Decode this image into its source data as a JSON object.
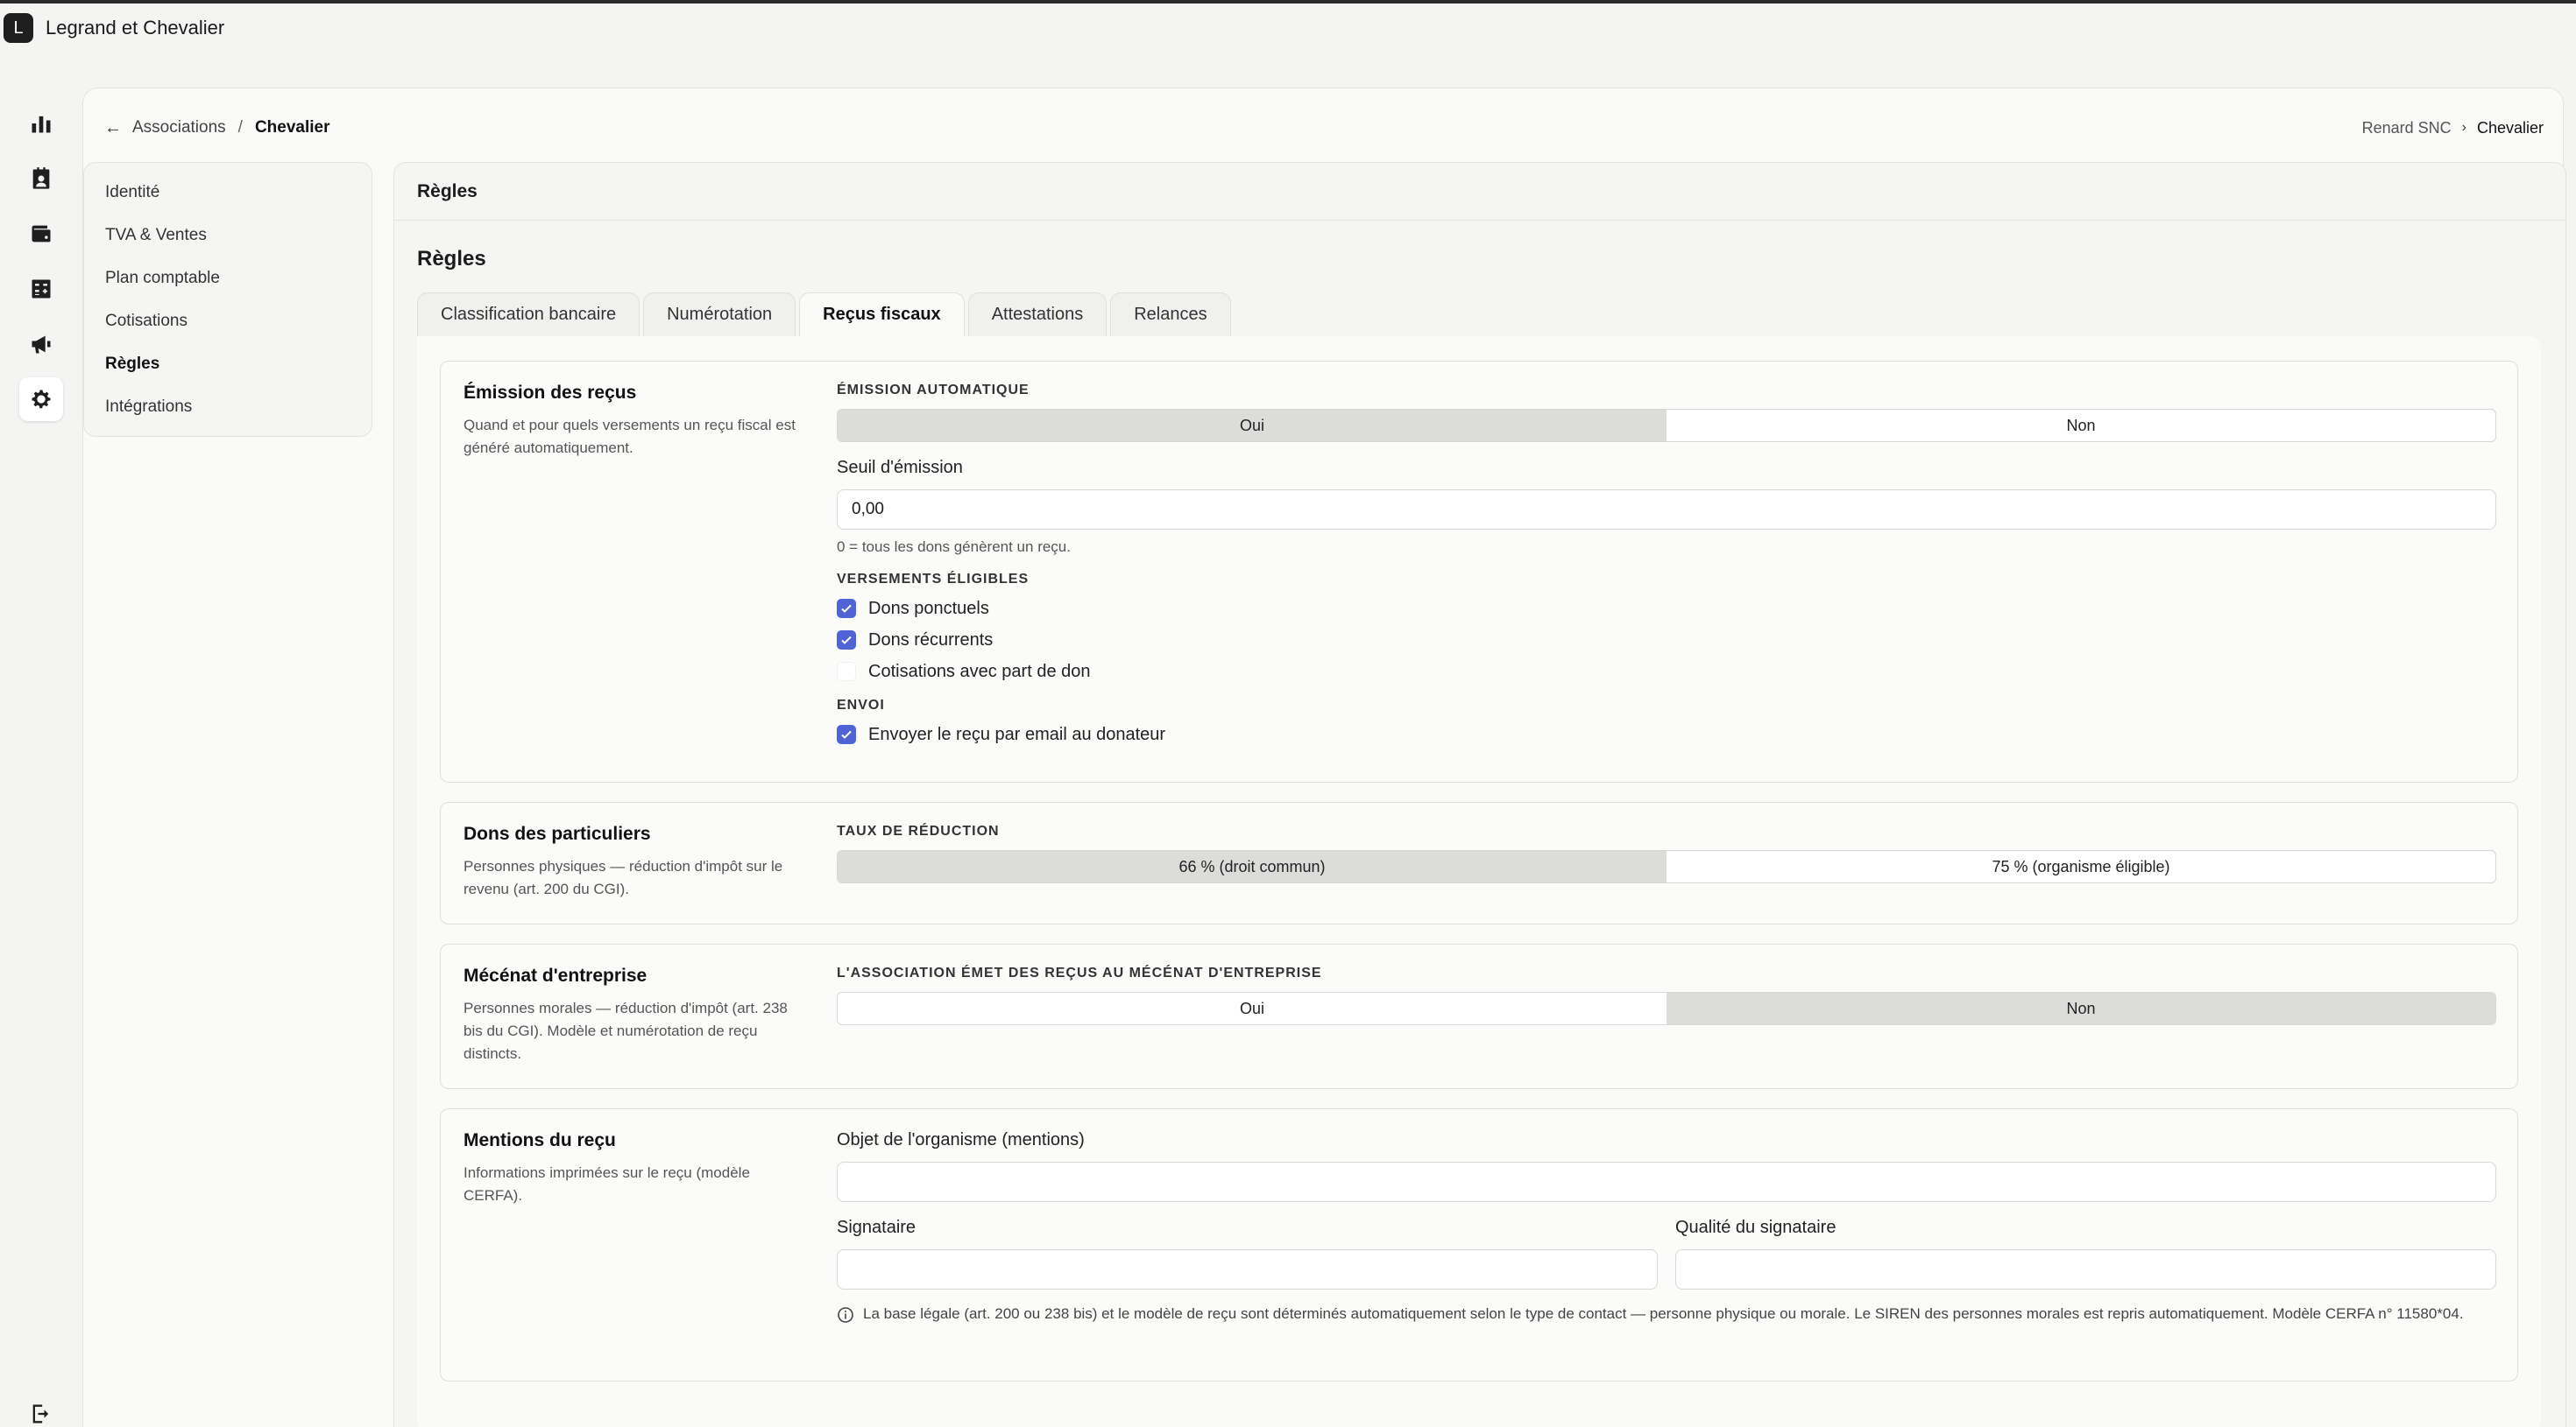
{
  "app": {
    "logo_letter": "L",
    "title": "Legrand et Chevalier"
  },
  "rail": {
    "items": [
      {
        "icon": "bar-chart-icon"
      },
      {
        "icon": "contacts-icon"
      },
      {
        "icon": "wallet-icon"
      },
      {
        "icon": "calculator-icon"
      },
      {
        "icon": "megaphone-icon"
      },
      {
        "icon": "gear-icon",
        "active": true
      }
    ],
    "logout_icon": "logout-icon"
  },
  "breadcrumb": {
    "back_icon": "arrow-left-icon",
    "parent": "Associations",
    "separator": "/",
    "current": "Chevalier"
  },
  "org_switcher": {
    "parent": "Renard SNC",
    "current": "Chevalier"
  },
  "subnav": {
    "items": [
      {
        "label": "Identité"
      },
      {
        "label": "TVA & Ventes"
      },
      {
        "label": "Plan comptable"
      },
      {
        "label": "Cotisations"
      },
      {
        "label": "Règles",
        "active": true
      },
      {
        "label": "Intégrations"
      }
    ]
  },
  "content": {
    "header": "Règles",
    "section_title": "Règles",
    "tabs": [
      {
        "label": "Classification bancaire"
      },
      {
        "label": "Numérotation"
      },
      {
        "label": "Reçus fiscaux",
        "active": true
      },
      {
        "label": "Attestations"
      },
      {
        "label": "Relances"
      }
    ]
  },
  "emission": {
    "title": "Émission des reçus",
    "description": "Quand et pour quels versements un reçu fiscal est généré automatiquement.",
    "auto_label": "Émission automatique",
    "auto_options": [
      "Oui",
      "Non"
    ],
    "auto_selected": "Oui",
    "threshold_label": "Seuil d'émission",
    "threshold_value": "0,00",
    "threshold_hint": "0 = tous les dons génèrent un reçu.",
    "eligible_label": "Versements éligibles",
    "eligible_items": [
      {
        "label": "Dons ponctuels",
        "checked": true
      },
      {
        "label": "Dons récurrents",
        "checked": true
      },
      {
        "label": "Cotisations avec part de don",
        "checked": false
      }
    ],
    "sending_label": "Envoi",
    "sending_items": [
      {
        "label": "Envoyer le reçu par email au donateur",
        "checked": true
      }
    ]
  },
  "individuals": {
    "title": "Dons des particuliers",
    "description": "Personnes physiques — réduction d'impôt sur le revenu (art. 200 du CGI).",
    "rate_label": "Taux de réduction",
    "rate_options": [
      "66 % (droit commun)",
      "75 % (organisme éligible)"
    ],
    "rate_selected": "66 % (droit commun)"
  },
  "corporate": {
    "title": "Mécénat d'entreprise",
    "description": "Personnes morales — réduction d'impôt (art. 238 bis du CGI). Modèle et numérotation de reçu distincts.",
    "question_label": "L'association émet des reçus au mécénat d'entreprise",
    "options": [
      "Oui",
      "Non"
    ],
    "selected": "Non"
  },
  "mentions": {
    "title": "Mentions du reçu",
    "description": "Informations imprimées sur le reçu (modèle CERFA).",
    "object_label": "Objet de l'organisme (mentions)",
    "object_value": "",
    "signatory_label": "Signataire",
    "signatory_value": "",
    "signatory_role_label": "Qualité du signataire",
    "signatory_role_value": "",
    "info_icon": "info-circle-icon",
    "info_text": "La base légale (art. 200 ou 238 bis) et le modèle de reçu sont déterminés automatiquement selon le type de contact — personne physique ou morale. Le SIREN des personnes morales est repris automatiquement. Modèle CERFA n° 11580*04."
  },
  "colors": {
    "accent": "#4f63d6",
    "selected_segment": "#dcdcdb",
    "text": "#1c1c1c"
  }
}
